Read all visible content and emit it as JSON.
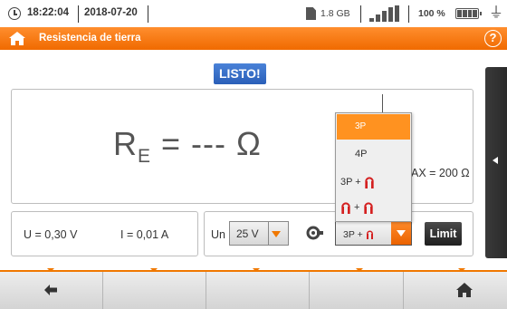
{
  "statusbar": {
    "time": "18:22:04",
    "date": "2018-07-20",
    "storage": "1.8 GB",
    "battery": "100 %"
  },
  "header": {
    "title": "Resistencia de tierra",
    "help_symbol": "?"
  },
  "status_badge": "LISTO!",
  "result": {
    "symbol": "R",
    "subscript": "E",
    "value": " = --- Ω",
    "rmax_visible": "AX = 200 Ω"
  },
  "measurements": {
    "voltage": "U = 0,30 V",
    "current": "I = 0,01 A"
  },
  "settings": {
    "un_label": "Un",
    "un_value": "25 V",
    "mode_value": "3P + ",
    "limit_label": "Limit"
  },
  "dropdown": {
    "options": [
      "3P",
      "4P",
      "3P + ",
      " + "
    ],
    "selected_index": 0
  },
  "colors": {
    "accent": "#f07800",
    "badge": "#2a5fb8",
    "clamp": "#d42020"
  },
  "icons": {
    "back": "arrow-left-icon",
    "home": "home-icon",
    "clamp": "clamp-icon"
  }
}
